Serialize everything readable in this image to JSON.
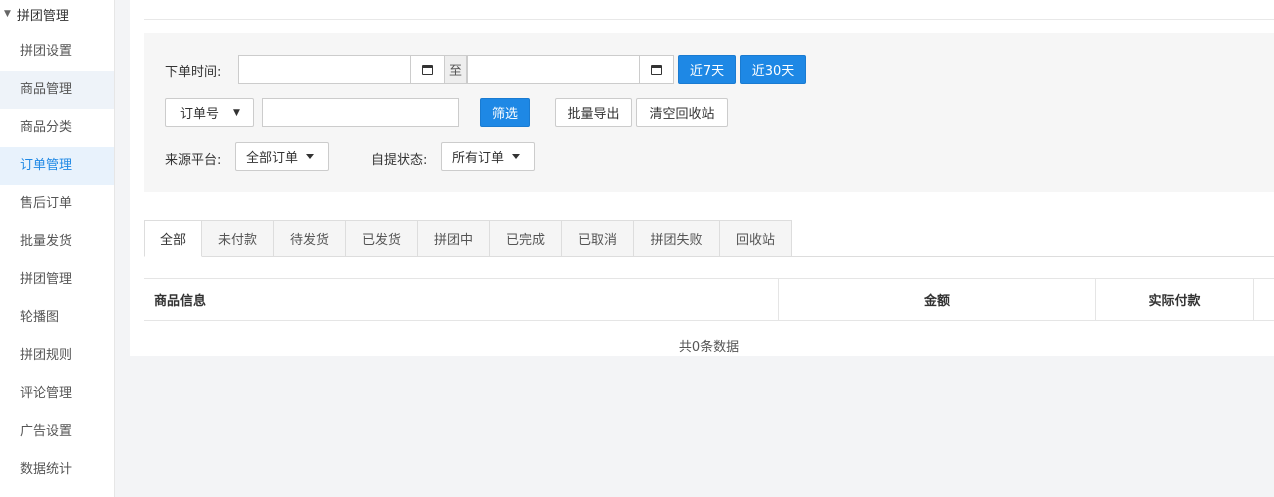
{
  "sidebar": {
    "group_label": "拼团管理",
    "items": [
      {
        "label": "拼团设置"
      },
      {
        "label": "商品管理"
      },
      {
        "label": "商品分类"
      },
      {
        "label": "订单管理"
      },
      {
        "label": "售后订单"
      },
      {
        "label": "批量发货"
      },
      {
        "label": "拼团管理"
      },
      {
        "label": "轮播图"
      },
      {
        "label": "拼团规则"
      },
      {
        "label": "评论管理"
      },
      {
        "label": "广告设置"
      },
      {
        "label": "数据统计"
      }
    ]
  },
  "filter": {
    "order_time_label": "下单时间:",
    "date_start": "",
    "date_end": "",
    "date_separator": "至",
    "last7_label": "近7天",
    "last30_label": "近30天",
    "search_field_selected": "订单号",
    "search_value": "",
    "filter_button": "筛选",
    "export_button": "批量导出",
    "clear_recycle_button": "清空回收站",
    "source_label": "来源平台:",
    "source_selected": "全部订单",
    "pickup_label": "自提状态:",
    "pickup_selected": "所有订单"
  },
  "tabs": [
    {
      "label": "全部"
    },
    {
      "label": "未付款"
    },
    {
      "label": "待发货"
    },
    {
      "label": "已发货"
    },
    {
      "label": "拼团中"
    },
    {
      "label": "已完成"
    },
    {
      "label": "已取消"
    },
    {
      "label": "拼团失败"
    },
    {
      "label": "回收站"
    }
  ],
  "table": {
    "columns": [
      "商品信息",
      "金额",
      "实际付款"
    ],
    "empty_text": "共0条数据"
  }
}
